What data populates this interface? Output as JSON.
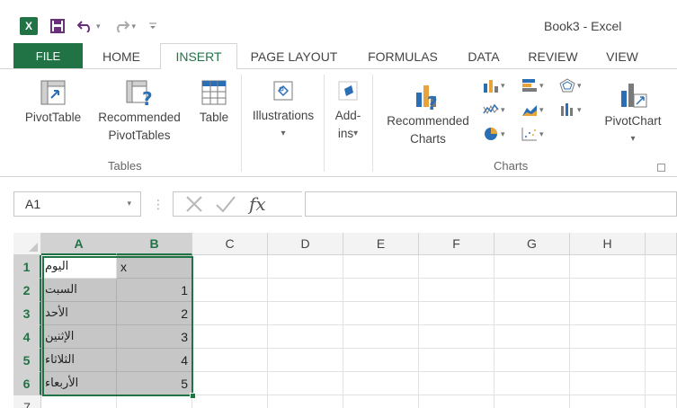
{
  "window": {
    "title": "Book3 - Excel"
  },
  "quick_access": {
    "logo_text": "X",
    "save_icon": "save-icon",
    "undo_icon": "undo-icon",
    "redo_icon": "redo-icon",
    "customize_icon": "customize-qat-icon"
  },
  "tabs": [
    {
      "label": "FILE"
    },
    {
      "label": "HOME"
    },
    {
      "label": "INSERT"
    },
    {
      "label": "PAGE LAYOUT"
    },
    {
      "label": "FORMULAS"
    },
    {
      "label": "DATA"
    },
    {
      "label": "REVIEW"
    },
    {
      "label": "VIEW"
    }
  ],
  "active_tab": "INSERT",
  "ribbon": {
    "tables": {
      "label": "Tables",
      "pivottable": "PivotTable",
      "recommended_line1": "Recommended",
      "recommended_line2": "PivotTables",
      "table": "Table"
    },
    "illustrations": "Illustrations",
    "addins_line1": "Add-",
    "addins_line2": "ins",
    "charts": {
      "label": "Charts",
      "recommended_line1": "Recommended",
      "recommended_line2": "Charts",
      "pivotchart": "PivotChart"
    }
  },
  "formula_bar": {
    "name_box": "A1",
    "fx": "fx",
    "value": ""
  },
  "columns": [
    "A",
    "B",
    "C",
    "D",
    "E",
    "F",
    "G",
    "H"
  ],
  "rows": [
    "1",
    "2",
    "3",
    "4",
    "5",
    "6",
    "7"
  ],
  "cells": {
    "A1": "اليوم",
    "B1": "x",
    "A2": "السبت",
    "B2": "1",
    "A3": "الأحد",
    "B3": "2",
    "A4": "الإثنين",
    "B4": "3",
    "A5": "الثلاثاء",
    "B5": "4",
    "A6": "الأربعاء",
    "B6": "5"
  },
  "colors": {
    "accent": "#217346",
    "selection_fill": "#c6c6c6"
  }
}
